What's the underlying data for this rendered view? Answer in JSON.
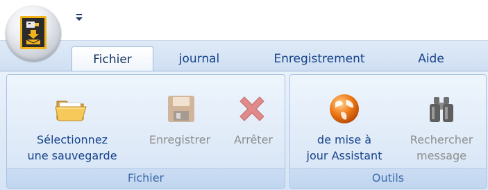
{
  "tabs": [
    {
      "label": "Fichier"
    },
    {
      "label": "journal"
    },
    {
      "label": "Enregistrement"
    },
    {
      "label": "Aide"
    }
  ],
  "groups": {
    "fichier": {
      "label": "Fichier",
      "buttons": {
        "select_backup": {
          "line1": "Sélectionnez",
          "line2": "une sauvegarde",
          "icon": "folder-icon"
        },
        "save": {
          "label": "Enregistrer",
          "icon": "save-disk-icon",
          "disabled": true
        },
        "stop": {
          "label": "Arrêter",
          "icon": "red-x-icon",
          "disabled": true
        }
      }
    },
    "outils": {
      "label": "Outils",
      "buttons": {
        "update_wizard": {
          "line1": "de mise à",
          "line2": "jour Assistant",
          "icon": "globe-icon"
        },
        "search_message": {
          "line1": "Rechercher",
          "line2": "message",
          "icon": "binoculars-icon",
          "disabled": true
        }
      }
    }
  },
  "colors": {
    "tab_text": "#15428b",
    "disabled_text": "#8d8d8d",
    "ribbon_bg": "#dde9f7",
    "group_border": "#aac3e2"
  }
}
